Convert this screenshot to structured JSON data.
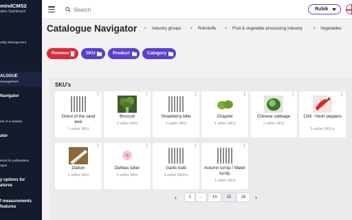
{
  "sidebar": {
    "brand": "mindCMS2",
    "brand_sub": "ation Dashboard",
    "items": [
      {
        "label": "rship Management"
      },
      {
        "label": "ALOGUE",
        "bold": true
      },
      {
        "label": "management"
      },
      {
        "label": "Navigator",
        "bold": true
      },
      {
        "label": "ent of a website"
      },
      {
        "label": "ator",
        "bold": true
      },
      {
        "label": "terial for publications"
      },
      {
        "label": "ogue"
      },
      {
        "label": "y options for"
      },
      {
        "label": "atures"
      },
      {
        "label": "f measurements"
      },
      {
        "label": "features"
      }
    ]
  },
  "topbar": {
    "search_placeholder": "Search",
    "language": "Rubik"
  },
  "header": {
    "title": "Catalogue Navigator",
    "breadcrumbs": [
      "Industry groups",
      "Rohstoffe",
      "Fruit & vegetable processing industry",
      "Vegetables"
    ]
  },
  "actions": {
    "remove": "Remove",
    "sku": "SKU",
    "product": "Product",
    "category": "Category"
  },
  "panel": {
    "title": "SKU's",
    "items": [
      {
        "name": "Onion of the sand leek",
        "sub": "1 seller SKU",
        "icon": "barcode-icon"
      },
      {
        "name": "Broccoli",
        "sub": "1 seller SKU",
        "icon": "broccoli-image"
      },
      {
        "name": "Strawberry blite",
        "sub": "1 seller SKU",
        "icon": "barcode-icon"
      },
      {
        "name": "Chayote",
        "sub": "1 seller SKU",
        "icon": "chayote-image"
      },
      {
        "name": "Chinese cabbage",
        "sub": "1 seller SKU",
        "icon": "cabbage-image"
      },
      {
        "name": "Chili - fresh peppers",
        "sub": "3 seller SKU's",
        "icon": "chili-image"
      },
      {
        "name": "Daikon",
        "sub": "1 seller SKU",
        "icon": "daikon-image"
      },
      {
        "name": "Dahlias tuber",
        "sub": "1 seller SKU",
        "icon": "dahlia-image"
      },
      {
        "name": "Garlic bulb",
        "sub": "3 seller SKU's",
        "icon": "barcode-icon"
      },
      {
        "name": "Autumn turnip / Water turnip",
        "sub": "1 seller SKU",
        "icon": "barcode-icon"
      }
    ]
  },
  "pagination": {
    "pages": [
      "1",
      "...",
      "14",
      "15",
      "16"
    ],
    "current": "15"
  },
  "colors": {
    "sidebar": "#141b2d",
    "accent": "#5b3fd0",
    "danger": "#d92b3a"
  }
}
